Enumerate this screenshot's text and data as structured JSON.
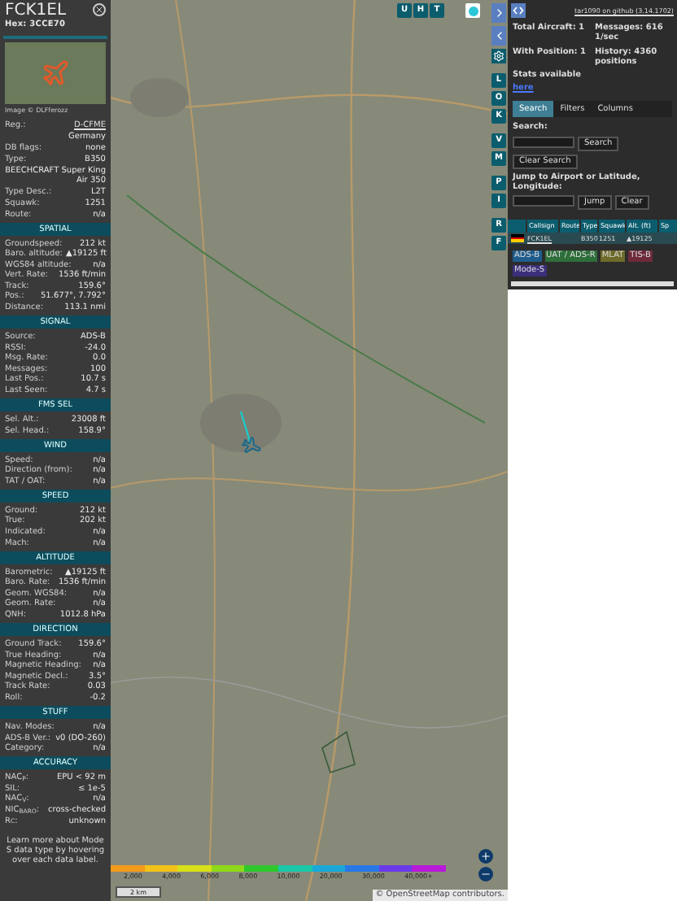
{
  "details": {
    "callsign": "FCK1EL",
    "hex": "Hex: 3CCE70",
    "photo_credit": "Image © DLFferozz",
    "info": [
      {
        "label": "Reg.:",
        "value": "D-CFME",
        "link": true
      },
      {
        "value": "Germany"
      },
      {
        "label": "DB flags:",
        "value": "none"
      },
      {
        "label": "Type:",
        "value": "B350"
      },
      {
        "value": "BEECHCRAFT Super King Air 350"
      },
      {
        "label": "Type Desc.:",
        "value": "L2T"
      },
      {
        "label": "Squawk:",
        "value": "1251"
      },
      {
        "label": "Route:",
        "value": "n/a"
      }
    ],
    "sections": [
      {
        "title": "SPATIAL",
        "rows": [
          {
            "label": "Groundspeed:",
            "value": "212 kt"
          },
          {
            "label": "Baro. altitude:",
            "value": "▲19125 ft"
          },
          {
            "label": "WGS84 altitude:",
            "value": "n/a"
          },
          {
            "label": "Vert. Rate:",
            "value": "1536 ft/min"
          },
          {
            "label": "Track:",
            "value": "159.6°"
          },
          {
            "label": "Pos.:",
            "value": "51.677°, 7.792°"
          },
          {
            "label": "Distance:",
            "value": "113.1 nmi"
          }
        ]
      },
      {
        "title": "SIGNAL",
        "rows": [
          {
            "label": "Source:",
            "value": "ADS-B"
          },
          {
            "label": "RSSI:",
            "value": "-24.0"
          },
          {
            "label": "Msg. Rate:",
            "value": "0.0"
          },
          {
            "label": "Messages:",
            "value": "100"
          },
          {
            "label": "Last Pos.:",
            "value": "10.7 s"
          },
          {
            "label": "Last Seen:",
            "value": "4.7 s"
          }
        ]
      },
      {
        "title": "FMS SEL",
        "rows": [
          {
            "label": "Sel. Alt.:",
            "value": "23008 ft"
          },
          {
            "label": "Sel. Head.:",
            "value": "158.9°"
          }
        ]
      },
      {
        "title": "WIND",
        "rows": [
          {
            "label": "Speed:",
            "value": "n/a"
          },
          {
            "label": "Direction (from):",
            "value": "n/a"
          },
          {
            "label": "TAT / OAT:",
            "value": "n/a"
          }
        ]
      },
      {
        "title": "SPEED",
        "rows": [
          {
            "label": "Ground:",
            "value": "212 kt"
          },
          {
            "label": "True:",
            "value": "202 kt"
          },
          {
            "label": "Indicated:",
            "value": "n/a"
          },
          {
            "label": "Mach:",
            "value": "n/a"
          }
        ]
      },
      {
        "title": "ALTITUDE",
        "rows": [
          {
            "label": "Barometric:",
            "value": "▲19125 ft"
          },
          {
            "label": "Baro. Rate:",
            "value": "1536 ft/min"
          },
          {
            "label": "Geom. WGS84:",
            "value": "n/a"
          },
          {
            "label": "Geom. Rate:",
            "value": "n/a"
          },
          {
            "label": "QNH:",
            "value": "1012.8 hPa"
          }
        ]
      },
      {
        "title": "DIRECTION",
        "rows": [
          {
            "label": "Ground Track:",
            "value": "159.6°"
          },
          {
            "label": "True Heading:",
            "value": "n/a"
          },
          {
            "label": "Magnetic Heading:",
            "value": "n/a"
          },
          {
            "label": "Magnetic Decl.:",
            "value": "3.5°"
          },
          {
            "label": "Track Rate:",
            "value": "0.03"
          },
          {
            "label": "Roll:",
            "value": "-0.2"
          }
        ]
      },
      {
        "title": "STUFF",
        "rows": [
          {
            "label": "Nav. Modes:",
            "value": "n/a"
          },
          {
            "label": "ADS-B Ver.:",
            "value": "v0 (DO-260)"
          },
          {
            "label": "Category:",
            "value": "n/a"
          }
        ]
      },
      {
        "title": "ACCURACY",
        "rows": [
          {
            "label": "NAC$_{P}$:",
            "value": "EPU < 92 m"
          },
          {
            "label": "SIL:",
            "value": "≤ 1e-5"
          },
          {
            "label": "NAC$_{V}$:",
            "value": "n/a"
          },
          {
            "label": "NIC$_{BARO}$:",
            "value": "cross-checked"
          },
          {
            "label": "R$_{C}$:",
            "value": "unknown"
          }
        ]
      }
    ],
    "footer": "Learn more about Mode S data type by hovering over each data label."
  },
  "map": {
    "top_buttons": [
      "U",
      "H",
      "T"
    ],
    "side_groups": [
      [
        "L",
        "O",
        "K"
      ],
      [
        "V",
        "M"
      ],
      [
        "P",
        "I"
      ],
      [
        "R",
        "F"
      ]
    ],
    "scale": "2 km",
    "attribution": "© OpenStreetMap contributors.",
    "altitude_ticks": [
      "2,000",
      "4,000",
      "6,000",
      "8,000",
      "10,000",
      "20,000",
      "30,000",
      "40,000+"
    ]
  },
  "sidebar": {
    "version_link": "tar1090 on github (3.14.1702)",
    "stats": [
      {
        "label": "Total Aircraft: 1"
      },
      {
        "label": "Messages: 616 1/sec"
      },
      {
        "label": "With Position: 1"
      },
      {
        "label": "History: 4360 positions"
      }
    ],
    "stats_text": "Stats available",
    "stats_link": "here",
    "tabs": [
      {
        "label": "Search",
        "selected": true
      },
      {
        "label": "Filters",
        "selected": false
      },
      {
        "label": "Columns",
        "selected": false
      }
    ],
    "search_label": "Search:",
    "search_button": "Search",
    "clear_search": "Clear Search",
    "jump_label": "Jump to Airport or Latitude, Longitude:",
    "jump_button": "Jump",
    "clear_button": "Clear",
    "table": {
      "columns": [
        "Callsign",
        "Route",
        "Type",
        "Squawk",
        "Alt. (ft)",
        "Sp"
      ],
      "rows": [
        {
          "cells": [
            "FCK1EL",
            "",
            "B350",
            "1251",
            "▲19125",
            ""
          ],
          "selected": false
        }
      ]
    },
    "sources": [
      {
        "label": "ADS-B",
        "color": "#1f5c8c"
      },
      {
        "label": "UAT / ADS-R",
        "color": "#2e6e3a"
      },
      {
        "label": "MLAT",
        "color": "#6e6a2a"
      },
      {
        "label": "TIS-B",
        "color": "#6e2a3a"
      },
      {
        "label": "Mode-S",
        "color": "#3a2f7a"
      }
    ]
  }
}
